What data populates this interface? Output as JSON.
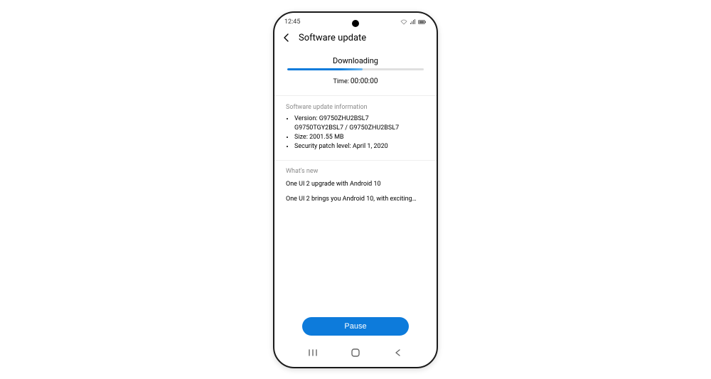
{
  "status": {
    "time": "12:45"
  },
  "header": {
    "title": "Software update"
  },
  "download": {
    "label": "Downloading",
    "time_label": "Time:",
    "time_value": "00:00:00",
    "progress_percent": 55
  },
  "info": {
    "section_label": "Software update information",
    "version_label": "Version:",
    "version_line1": "G9750ZHU2BSL7",
    "version_line2": "G9750TGY2BSL7 / G9750ZHU2BSL7",
    "size_label": "Size:",
    "size_value": "2001.55 MB",
    "patch_label": "Security patch level:",
    "patch_value": "April 1, 2020"
  },
  "whatsnew": {
    "section_label": "What's new",
    "headline": "One UI 2 upgrade with Android 10",
    "body": "One UI 2 brings you Android 10, with exciting…"
  },
  "actions": {
    "pause": "Pause"
  }
}
